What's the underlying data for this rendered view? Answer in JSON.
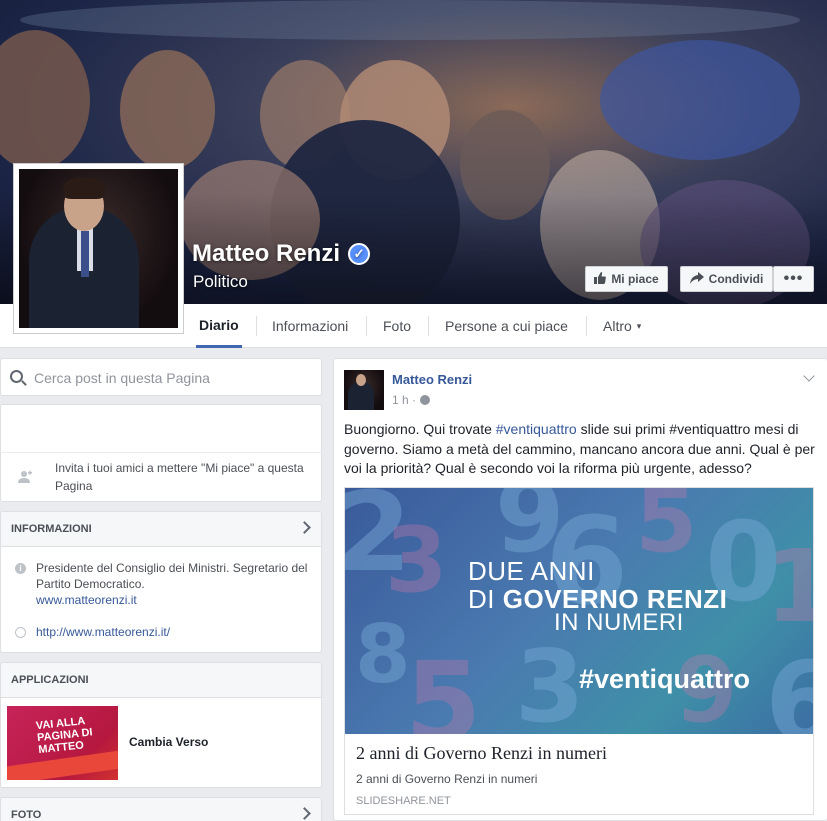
{
  "page": {
    "name": "Matteo Renzi",
    "category": "Politico"
  },
  "cover_actions": {
    "like": "Mi piace",
    "share": "Condividi",
    "more": "•••"
  },
  "tabs": [
    "Diario",
    "Informazioni",
    "Foto",
    "Persone a cui piace",
    "Altro"
  ],
  "tab_more_arrow": "▾",
  "search": {
    "placeholder": "Cerca post in questa Pagina"
  },
  "invite": {
    "text": "Invita i tuoi amici a mettere \"Mi piace\" a questa Pagina"
  },
  "info_section": {
    "heading": "INFORMAZIONI",
    "description": "Presidente del Consiglio dei Ministri. Segretario del Partito Democratico.",
    "description_link": "www.matteorenzi.it",
    "website": "http://www.matteorenzi.it/"
  },
  "apps_section": {
    "heading": "APPLICAZIONI",
    "app_thumb_text": "VAI ALLA PAGINA DI MATTEO",
    "app_name": "Cambia Verso"
  },
  "photos_section": {
    "heading": "FOTO"
  },
  "post": {
    "author": "Matteo Renzi",
    "time": "1 h ·",
    "text_1": "Buongiorno. Qui trovate ",
    "hashtag_1": "#ventiquattro",
    "text_2": " slide sui primi #ventiquattro mesi di governo. Siamo a metà del cammino, mancano ancora due anni. Qual è per voi la priorità? Qual è secondo voi la riforma più urgente, adesso?",
    "preview": {
      "image_line1": "DUE ANNI",
      "image_line2_prefix": "DI ",
      "image_line2_bold": "GOVERNO RENZI",
      "image_line3": "IN NUMERI",
      "image_hashtag": "#ventiquattro",
      "title": "2 anni di Governo Renzi in numeri",
      "description": "2 anni di Governo Renzi in numeri",
      "source": "SLIDESHARE.NET"
    }
  },
  "colors": {
    "link": "#365899",
    "tab_active_underline": "#4267b2",
    "verified": "#5890ff",
    "background": "#e9ebee"
  },
  "icons": {
    "verified": "verified-check-icon",
    "like": "thumbs-up-icon",
    "share": "share-arrow-icon",
    "search": "search-icon",
    "invite": "add-friend-icon",
    "info": "info-icon",
    "globe": "globe-icon",
    "chevron": "chevron-right-icon"
  }
}
